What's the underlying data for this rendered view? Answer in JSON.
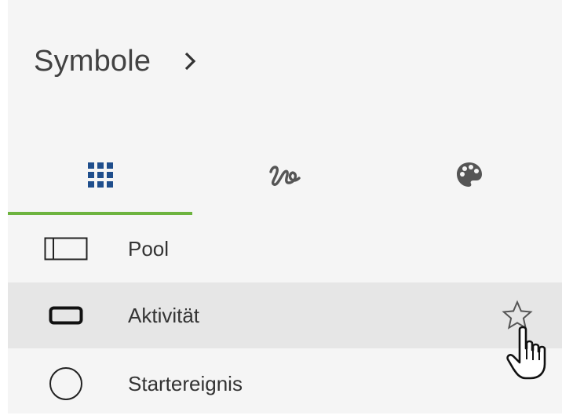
{
  "header": {
    "title": "Symbole",
    "chevron_icon": "chevron-right-icon"
  },
  "tabs": [
    {
      "icon": "grid-icon",
      "active": true
    },
    {
      "icon": "scribble-icon",
      "active": false
    },
    {
      "icon": "palette-icon",
      "active": false
    }
  ],
  "colors": {
    "panel_bg": "#f5f5f5",
    "hover_row_bg": "#e6e6e6",
    "active_tab_underline": "#6db33f",
    "grid_icon": "#1f4e8c",
    "text": "#333333"
  },
  "items": [
    {
      "label": "Pool",
      "icon": "pool-shape-icon"
    },
    {
      "label": "Aktivität",
      "icon": "activity-shape-icon",
      "hovered": true,
      "favorite_icon": "star-outline-icon"
    },
    {
      "label": "Startereignis",
      "icon": "start-event-circle-icon"
    }
  ]
}
